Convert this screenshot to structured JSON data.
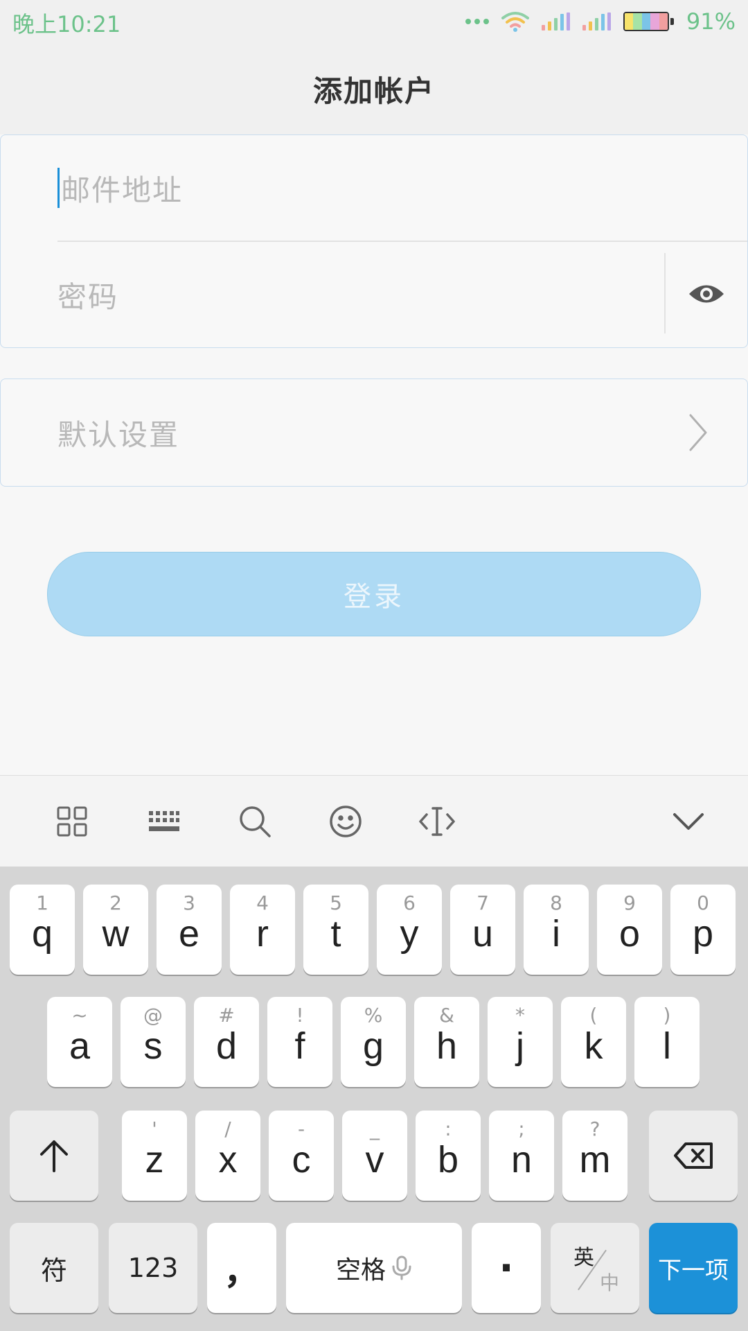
{
  "status_bar": {
    "time": "晚上10:21",
    "battery_percent": "91%",
    "colors": {
      "status_text": "#6cc28a"
    },
    "icons": [
      "more-dots-icon",
      "wifi-icon",
      "signal-icon",
      "signal-icon",
      "battery-icon"
    ]
  },
  "header": {
    "title": "添加帐户"
  },
  "form": {
    "email_placeholder": "邮件地址",
    "password_placeholder": "密码",
    "defaults_label": "默认设置",
    "login_label": "登录"
  },
  "toolbar": {
    "icons": [
      "grid-icon",
      "keyboard-icon",
      "search-icon",
      "emoji-icon",
      "cursor-icon",
      "collapse-icon"
    ]
  },
  "keyboard": {
    "row1": [
      {
        "main": "q",
        "sub": "1"
      },
      {
        "main": "w",
        "sub": "2"
      },
      {
        "main": "e",
        "sub": "3"
      },
      {
        "main": "r",
        "sub": "4"
      },
      {
        "main": "t",
        "sub": "5"
      },
      {
        "main": "y",
        "sub": "6"
      },
      {
        "main": "u",
        "sub": "7"
      },
      {
        "main": "i",
        "sub": "8"
      },
      {
        "main": "o",
        "sub": "9"
      },
      {
        "main": "p",
        "sub": "0"
      }
    ],
    "row2": [
      {
        "main": "a",
        "sub": "~"
      },
      {
        "main": "s",
        "sub": "@"
      },
      {
        "main": "d",
        "sub": "#"
      },
      {
        "main": "f",
        "sub": "!"
      },
      {
        "main": "g",
        "sub": "%"
      },
      {
        "main": "h",
        "sub": "&"
      },
      {
        "main": "j",
        "sub": "*"
      },
      {
        "main": "k",
        "sub": "("
      },
      {
        "main": "l",
        "sub": ")"
      }
    ],
    "row3": [
      {
        "main": "z",
        "sub": "'"
      },
      {
        "main": "x",
        "sub": "/"
      },
      {
        "main": "c",
        "sub": "-"
      },
      {
        "main": "v",
        "sub": "_"
      },
      {
        "main": "b",
        "sub": ":"
      },
      {
        "main": "n",
        "sub": ";"
      },
      {
        "main": "m",
        "sub": "?"
      }
    ],
    "symbols_label": "符",
    "numbers_label": "123",
    "comma_label": "，",
    "space_label": "空格",
    "period_label": "·",
    "lang_en": "英",
    "lang_zh": "中",
    "next_label": "下一项",
    "colors": {
      "action_key": "#1c91d8"
    }
  }
}
